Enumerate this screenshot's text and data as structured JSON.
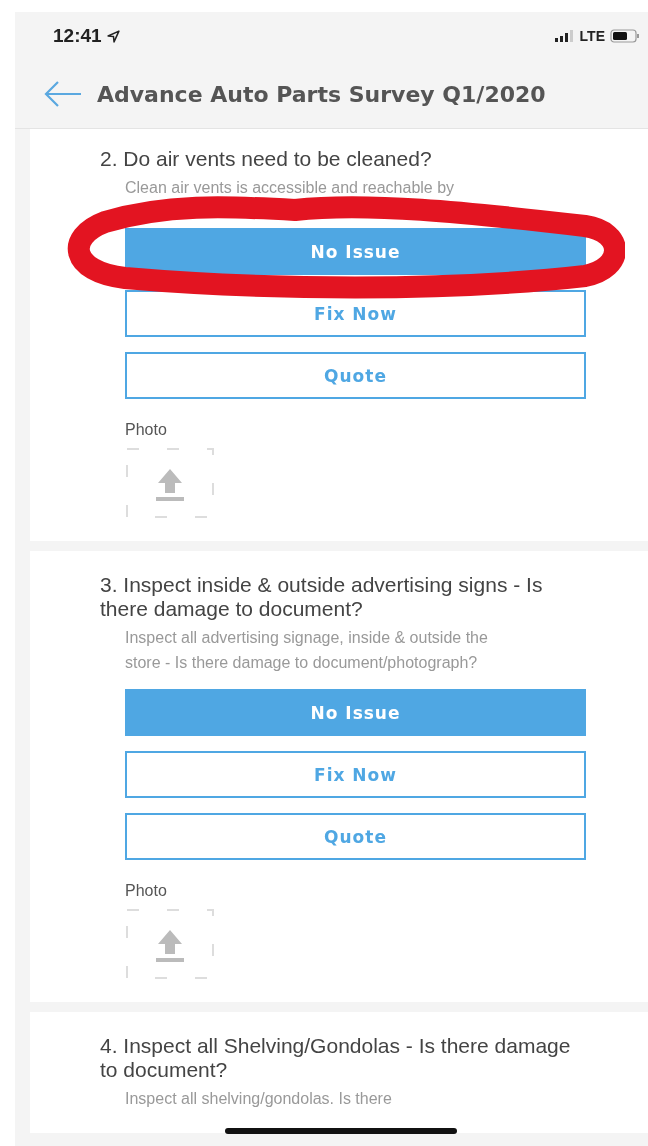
{
  "status_bar": {
    "time": "12:41",
    "network": "LTE"
  },
  "header": {
    "title": "Advance Auto Parts Survey Q1/2020"
  },
  "questions": [
    {
      "title": "2. Do air vents need to be cleaned?",
      "description": "Clean air vents is accessible and reachable by",
      "options": [
        {
          "label": "No Issue",
          "selected": true
        },
        {
          "label": "Fix Now",
          "selected": false
        },
        {
          "label": "Quote",
          "selected": false
        }
      ],
      "photo_label": "Photo"
    },
    {
      "title": "3. Inspect inside & outside advertising signs - Is there damage to document?",
      "description": "Inspect all advertising signage, inside & outside the store - Is there damage to document/photograph?",
      "options": [
        {
          "label": "No Issue",
          "selected": true
        },
        {
          "label": "Fix Now",
          "selected": false
        },
        {
          "label": "Quote",
          "selected": false
        }
      ],
      "photo_label": "Photo"
    },
    {
      "title": "4. Inspect all Shelving/Gondolas - Is there damage to document?",
      "description": "Inspect all shelving/gondolas. Is there"
    }
  ]
}
